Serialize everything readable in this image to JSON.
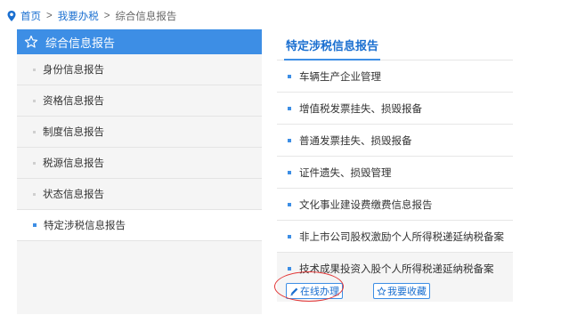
{
  "breadcrumb": {
    "home": "首页",
    "sep1": ">",
    "section": "我要办税",
    "sep2": ">",
    "current": "综合信息报告"
  },
  "sidebar": {
    "header": "综合信息报告",
    "items": [
      {
        "label": "身份信息报告"
      },
      {
        "label": "资格信息报告"
      },
      {
        "label": "制度信息报告"
      },
      {
        "label": "税源信息报告"
      },
      {
        "label": "状态信息报告"
      },
      {
        "label": "特定涉税信息报告",
        "active": true
      }
    ]
  },
  "main": {
    "title": "特定涉税信息报告",
    "items": [
      {
        "label": "车辆生产企业管理"
      },
      {
        "label": "增值税发票挂失、损毁报备"
      },
      {
        "label": "普通发票挂失、损毁报备"
      },
      {
        "label": "证件遗失、损毁管理"
      },
      {
        "label": "文化事业建设费缴费信息报告"
      },
      {
        "label": "非上市公司股权激励个人所得税递延纳税备案"
      },
      {
        "label": "技术成果投资入股个人所得税递延纳税备案"
      }
    ],
    "online_button": "在线办理",
    "favorite_button": "我要收藏"
  },
  "colors": {
    "accent": "#3d8ee5",
    "link": "#1a6fd0",
    "highlight_circle": "#e23434"
  }
}
